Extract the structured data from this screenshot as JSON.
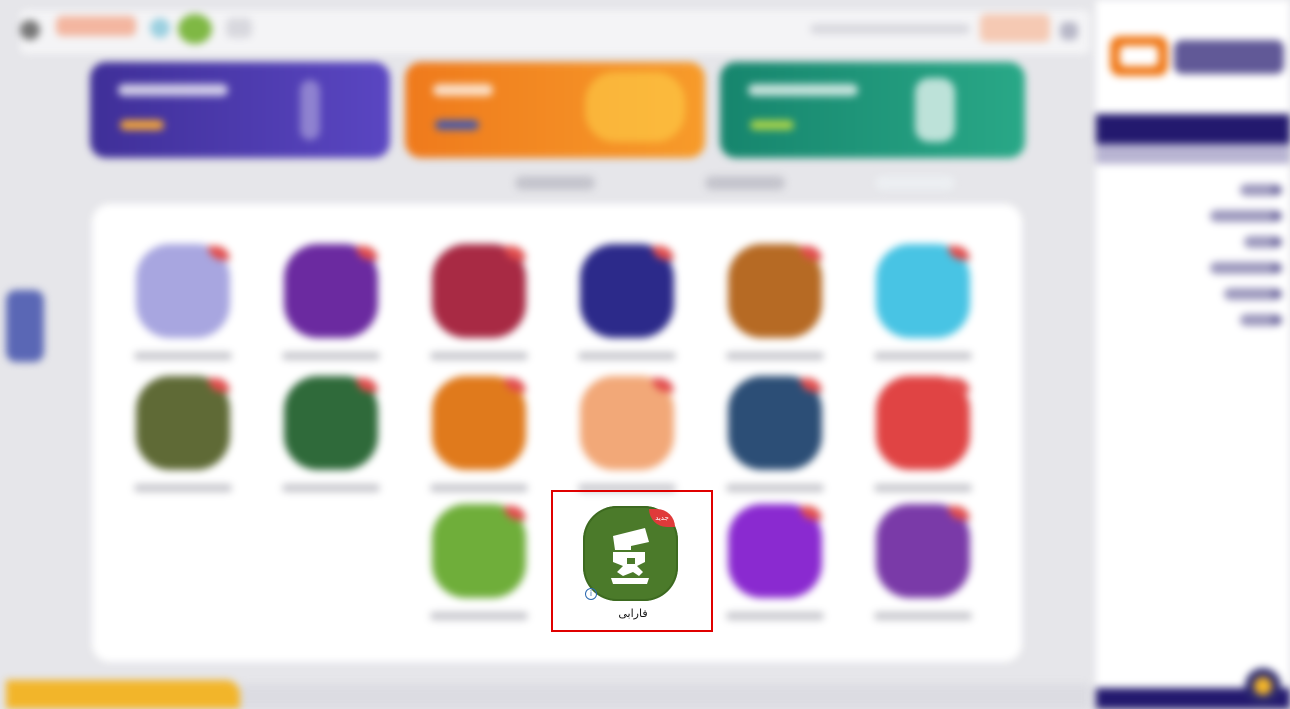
{
  "app": {
    "name": "فارابی",
    "new_badge": "جدید",
    "info_icon": "info-icon"
  },
  "colors": {
    "highlight_border": "#e00000",
    "farabi_tile": "#4b7a2a",
    "sidebar_header": "#23196e",
    "brand_orange": "#f07a1b"
  }
}
